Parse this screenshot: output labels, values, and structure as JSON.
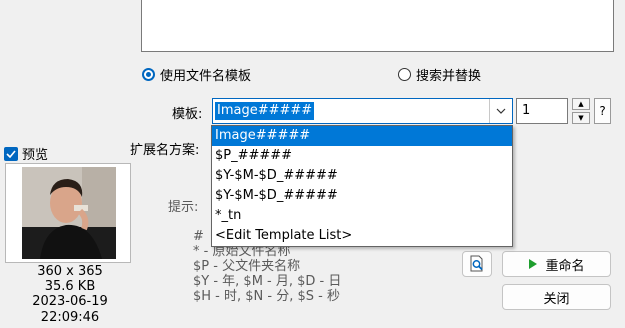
{
  "options": {
    "use_template_label": "使用文件名模板",
    "search_replace_label": "搜索并替换",
    "use_template_selected": true
  },
  "template": {
    "label": "模板:",
    "value": "Image#####",
    "dropdown_items": [
      "Image#####",
      "$P_#####",
      "$Y-$M-$D_#####",
      "$Y-$M-$D_#####",
      "*_tn",
      "<Edit Template List>"
    ],
    "selected_index": 0,
    "start_number": "1",
    "help_label": "?"
  },
  "extension": {
    "label": "扩展名方案:"
  },
  "preview": {
    "label": "预览",
    "checked": true,
    "dimensions": "360 x 365",
    "size": "35.6 KB",
    "datetime": "2023-06-19 22:09:46"
  },
  "hints": {
    "label": "提示:",
    "lines": [
      "#",
      "* - 原始文件名称",
      "$P - 父文件夹名称",
      "$Y - 年, $M - 月, $D - 日",
      "$H - 时, $N - 分, $S - 秒"
    ]
  },
  "buttons": {
    "rename_label": "重命名",
    "close_label": "关闭"
  },
  "colors": {
    "accent": "#0067c0",
    "selection": "#0078d7",
    "play_green": "#1e9e2e"
  }
}
